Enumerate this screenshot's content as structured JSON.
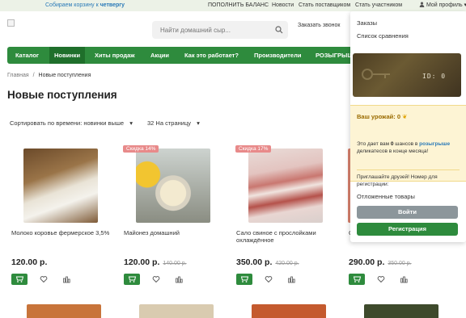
{
  "topbar": {
    "promo_prefix": "Собираем корзину к ",
    "promo_day": "четвергу",
    "links": [
      "ПОПОЛНИТЬ БАЛАНС",
      "Новости",
      "Стать поставщиком",
      "Стать участником"
    ],
    "profile": "Мой профиль"
  },
  "search": {
    "placeholder": "Найти домашний сыр..."
  },
  "header": {
    "callback": "Заказать звонок"
  },
  "nav": {
    "items": [
      "Каталог",
      "Новинки",
      "Хиты продаж",
      "Акции",
      "Как это работает?",
      "Производители",
      "РОЗЫГРЫШ"
    ]
  },
  "breadcrumb": {
    "home": "Главная",
    "sep": "/",
    "current": "Новые поступления"
  },
  "page": {
    "title": "Новые поступления"
  },
  "sort": {
    "by": "Сортировать по времени: новинки выше",
    "per_page": "32 На страницу"
  },
  "products": [
    {
      "name": "Молоко коровье фермерское 3,5%",
      "price": "120.00 р.",
      "old_price": "",
      "badge": ""
    },
    {
      "name": "Майонез домашний",
      "price": "120.00 р.",
      "old_price": "140.00 р.",
      "badge": "Скидка 14%"
    },
    {
      "name": "Сало свиное с прослойками охлаждённое",
      "price": "350.00 р.",
      "old_price": "420.00 р.",
      "badge": "Скидка 17%"
    },
    {
      "name": "С",
      "price": "290.00 р.",
      "old_price": "350.00 р.",
      "badge": ""
    }
  ],
  "dropdown": {
    "orders": "Заказы",
    "compare": "Список сравнения",
    "card_id": "ID: 0",
    "harvest_title": "Ваш урожай: 0",
    "harvest_text_1": "Это дает вам ",
    "harvest_count": "0",
    "harvest_text_2": " шансов в ",
    "harvest_link": "розыгрыше",
    "harvest_text_3": " деликатесов в конце месяца!",
    "invite": "Приглашайте друзей! Номер для регистрации:",
    "deferred": "Отложенные товары",
    "login": "Войти",
    "register": "Регистрация"
  },
  "colors": {
    "accent": "#2e8b3d",
    "link": "#2a7ab8",
    "badge": "#e88a8a"
  }
}
